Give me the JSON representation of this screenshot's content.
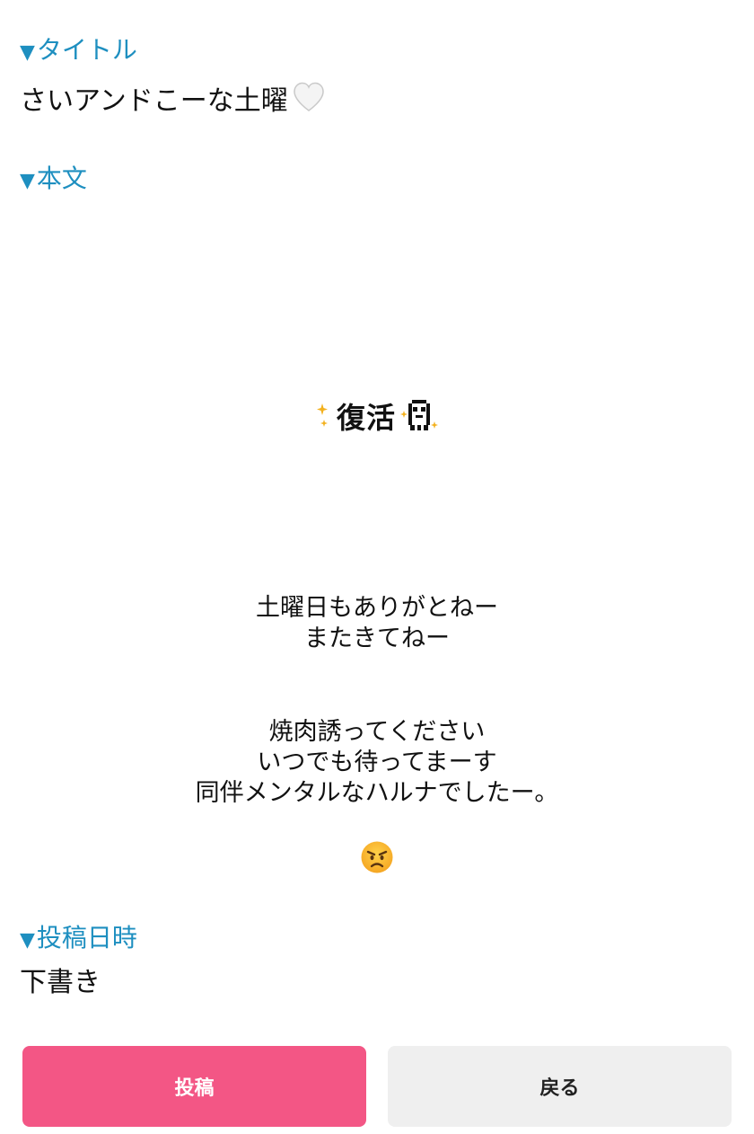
{
  "title_section": {
    "label": "タイトル",
    "value": "さいアンドこーな土曜"
  },
  "body_section": {
    "label": "本文",
    "sticker_text": "復活",
    "paragraph1": [
      "土曜日もありがとねー",
      "またきてねー"
    ],
    "paragraph2": [
      "焼肉誘ってください",
      "いつでも待ってまーす",
      "同伴メンタルなハルナでしたー。"
    ],
    "emoji": "angry-face"
  },
  "date_section": {
    "label": "投稿日時",
    "value": "下書き"
  },
  "buttons": {
    "post": "投稿",
    "back": "戻る"
  },
  "colors": {
    "label": "#1e8fc0",
    "post_button": "#f35685",
    "back_button": "#efefef"
  },
  "icons": {
    "title_suffix": "white-heart-icon",
    "label_marker": "triangle-down-icon"
  }
}
